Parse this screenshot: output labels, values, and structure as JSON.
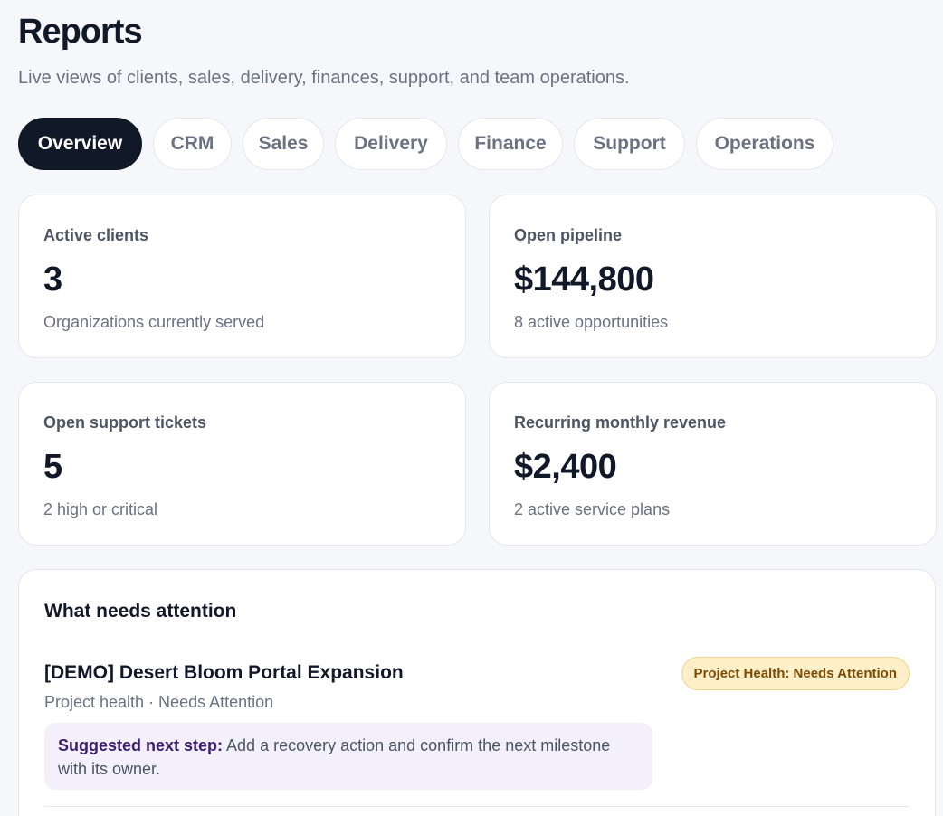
{
  "header": {
    "title": "Reports",
    "subtitle": "Live views of clients, sales, delivery, finances, support, and team operations."
  },
  "tabs": [
    {
      "label": "Overview",
      "active": true
    },
    {
      "label": "CRM",
      "active": false
    },
    {
      "label": "Sales",
      "active": false
    },
    {
      "label": "Delivery",
      "active": false
    },
    {
      "label": "Finance",
      "active": false
    },
    {
      "label": "Support",
      "active": false
    },
    {
      "label": "Operations",
      "active": false
    }
  ],
  "kpis": [
    {
      "label": "Active clients",
      "value": "3",
      "note": "Organizations currently served"
    },
    {
      "label": "Open pipeline",
      "value": "$144,800",
      "note": "8 active opportunities"
    },
    {
      "label": "Open support tickets",
      "value": "5",
      "note": "2 high or critical"
    },
    {
      "label": "Recurring monthly revenue",
      "value": "$2,400",
      "note": "2 active service plans"
    }
  ],
  "attention": {
    "title": "What needs attention",
    "items": [
      {
        "title": "[DEMO] Desert Bloom Portal Expansion",
        "meta": "Project health · Needs Attention",
        "badge": "Project Health: Needs Attention",
        "next_step_label": "Suggested next step:",
        "next_step_text": " Add a recovery action and confirm the next milestone with its owner."
      }
    ]
  },
  "colors": {
    "background": "#f6f7fb",
    "active_tab": "#111827",
    "badge_bg": "#fdf0c8",
    "badge_text": "#7c4a03",
    "next_step_bg": "#f3f0fc",
    "next_step_label": "#3b1f6b"
  }
}
